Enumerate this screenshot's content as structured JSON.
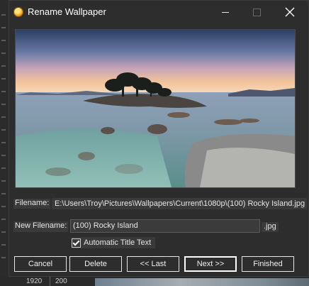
{
  "window": {
    "title": "Rename Wallpaper"
  },
  "fields": {
    "filename_label": "Filename:",
    "filename_value": "E:\\Users\\Troy\\Pictures\\Wallpapers\\Current\\1080p\\(100) Rocky Island.jpg",
    "new_filename_label": "New Filename:",
    "new_filename_value": "(100) Rocky Island",
    "extension": ".jpg",
    "auto_title_label": "Automatic Title Text",
    "auto_title_checked": true
  },
  "buttons": {
    "cancel": "Cancel",
    "delete": "Delete",
    "last": "<< Last",
    "next": "Next >>",
    "finished": "Finished"
  },
  "background": {
    "status_left": "1920",
    "status_right": "200"
  },
  "colors": {
    "dialog_bg": "#2d2d2d",
    "text": "#e6e6e6",
    "border": "#e6e6e6"
  }
}
